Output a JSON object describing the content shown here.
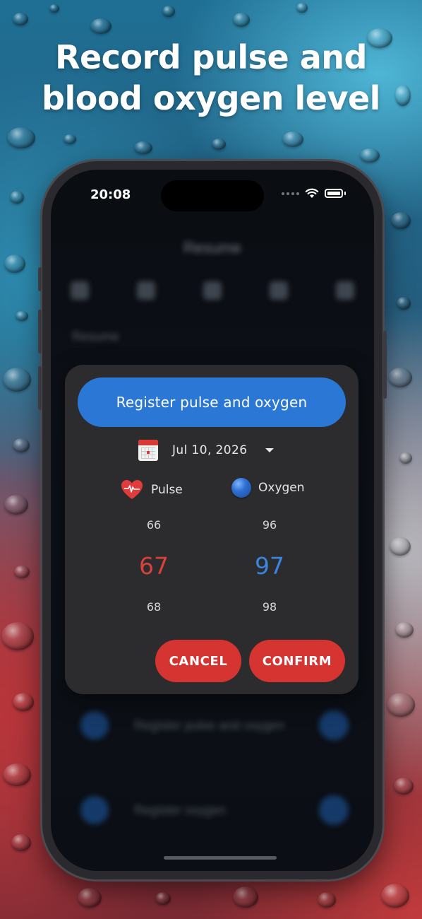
{
  "headline": {
    "line1": "Record pulse and",
    "line2": "blood oxygen level"
  },
  "status_bar": {
    "time": "20:08",
    "icons": [
      "signal-dots-icon",
      "wifi-icon",
      "battery-icon"
    ]
  },
  "background_app": {
    "title": "Resume",
    "tab_icons": [
      "home-icon",
      "chart-icon",
      "calendar-icon",
      "user-icon",
      "settings-icon"
    ],
    "section_label": "Resume",
    "rows": [
      {
        "label": "Register pulse and oxygen",
        "icon": "heart-oxygen-icon"
      },
      {
        "label": "Register oxygen",
        "icon": "oxygen-icon"
      }
    ]
  },
  "dialog": {
    "title": "Register pulse and oxygen",
    "date": "Jul 10, 2026",
    "pulse": {
      "label": "Pulse",
      "prev": "66",
      "selected": "67",
      "next": "68",
      "color": "#d8423c"
    },
    "oxygen": {
      "label": "Oxygen",
      "prev": "96",
      "selected": "97",
      "next": "98",
      "color": "#3a85de"
    },
    "cancel_label": "CANCEL",
    "confirm_label": "CONFIRM",
    "accent_color": "#2a77d6",
    "button_color": "#d53430"
  }
}
